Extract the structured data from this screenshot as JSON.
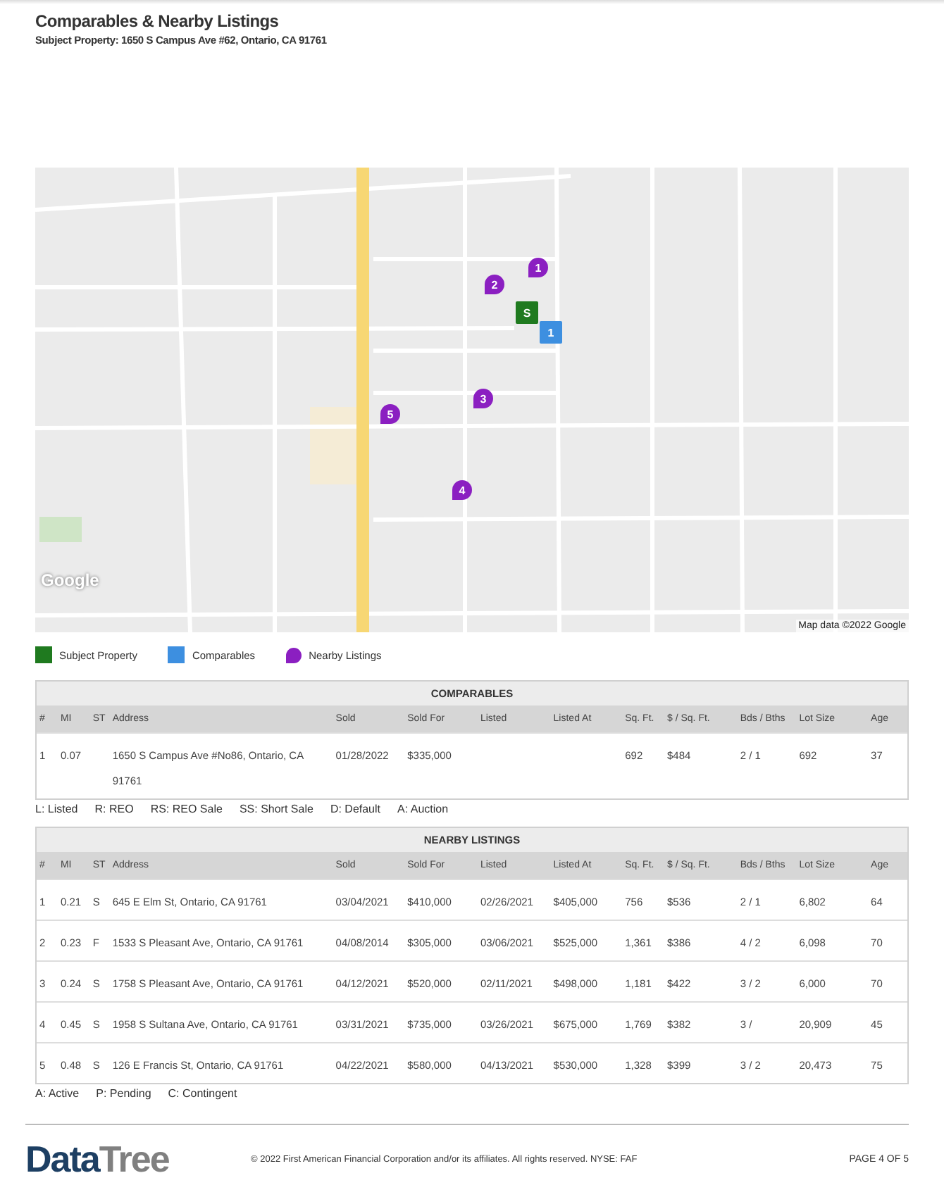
{
  "header": {
    "title": "Comparables & Nearby Listings",
    "subtitle": "Subject Property: 1650 S Campus Ave #62, Ontario, CA 91761"
  },
  "map": {
    "logo": "Google",
    "attribution": "Map data ©2022 Google",
    "markers": [
      {
        "kind": "nearby",
        "label": "1"
      },
      {
        "kind": "nearby",
        "label": "2"
      },
      {
        "kind": "subject",
        "label": "S"
      },
      {
        "kind": "comparable",
        "label": "1"
      },
      {
        "kind": "nearby",
        "label": "3"
      },
      {
        "kind": "nearby",
        "label": "5"
      },
      {
        "kind": "nearby",
        "label": "4"
      }
    ]
  },
  "legend": [
    {
      "kind": "subject",
      "label": "Subject Property"
    },
    {
      "kind": "comparable",
      "label": "Comparables"
    },
    {
      "kind": "nearby",
      "label": "Nearby Listings"
    }
  ],
  "comparables": {
    "title": "COMPARABLES",
    "columns": [
      "#",
      "MI",
      "ST",
      "Address",
      "Sold",
      "Sold For",
      "Listed",
      "Listed At",
      "Sq. Ft.",
      "$ / Sq. Ft.",
      "Bds / Bths",
      "Lot Size",
      "Age"
    ],
    "rows": [
      [
        "1",
        "0.07",
        null,
        "1650 S Campus Ave #No86, Ontario, CA 91761",
        "01/28/2022",
        "$335,000",
        null,
        null,
        "692",
        "$484",
        "2 / 1",
        "692",
        "37"
      ]
    ],
    "key": [
      "L: Listed",
      "R: REO",
      "RS: REO Sale",
      "SS: Short Sale",
      "D: Default",
      "A: Auction"
    ]
  },
  "nearby": {
    "title": "NEARBY LISTINGS",
    "columns": [
      "#",
      "MI",
      "ST",
      "Address",
      "Sold",
      "Sold For",
      "Listed",
      "Listed At",
      "Sq. Ft.",
      "$ / Sq. Ft.",
      "Bds / Bths",
      "Lot Size",
      "Age"
    ],
    "rows": [
      [
        "1",
        "0.21",
        "S",
        "645 E Elm St, Ontario, CA 91761",
        "03/04/2021",
        "$410,000",
        "02/26/2021",
        "$405,000",
        "756",
        "$536",
        "2 / 1",
        "6,802",
        "64"
      ],
      [
        "2",
        "0.23",
        "F",
        "1533 S Pleasant Ave, Ontario, CA 91761",
        "04/08/2014",
        "$305,000",
        "03/06/2021",
        "$525,000",
        "1,361",
        "$386",
        "4 / 2",
        "6,098",
        "70"
      ],
      [
        "3",
        "0.24",
        "S",
        "1758 S Pleasant Ave, Ontario, CA 91761",
        "04/12/2021",
        "$520,000",
        "02/11/2021",
        "$498,000",
        "1,181",
        "$422",
        "3 / 2",
        "6,000",
        "70"
      ],
      [
        "4",
        "0.45",
        "S",
        "1958 S Sultana Ave, Ontario, CA 91761",
        "03/31/2021",
        "$735,000",
        "03/26/2021",
        "$675,000",
        "1,769",
        "$382",
        "3 /",
        "20,909",
        "45"
      ],
      [
        "5",
        "0.48",
        "S",
        "126 E Francis St, Ontario, CA 91761",
        "04/22/2021",
        "$580,000",
        "04/13/2021",
        "$530,000",
        "1,328",
        "$399",
        "3 / 2",
        "20,473",
        "75"
      ]
    ],
    "key": [
      "A: Active",
      "P: Pending",
      "C: Contingent"
    ]
  },
  "footer": {
    "logo_first": "Data",
    "logo_second": "Tree",
    "copyright": "© 2022 First American Financial Corporation and/or its affiliates. All rights reserved. NYSE: FAF",
    "page": "PAGE 4 OF 5"
  }
}
